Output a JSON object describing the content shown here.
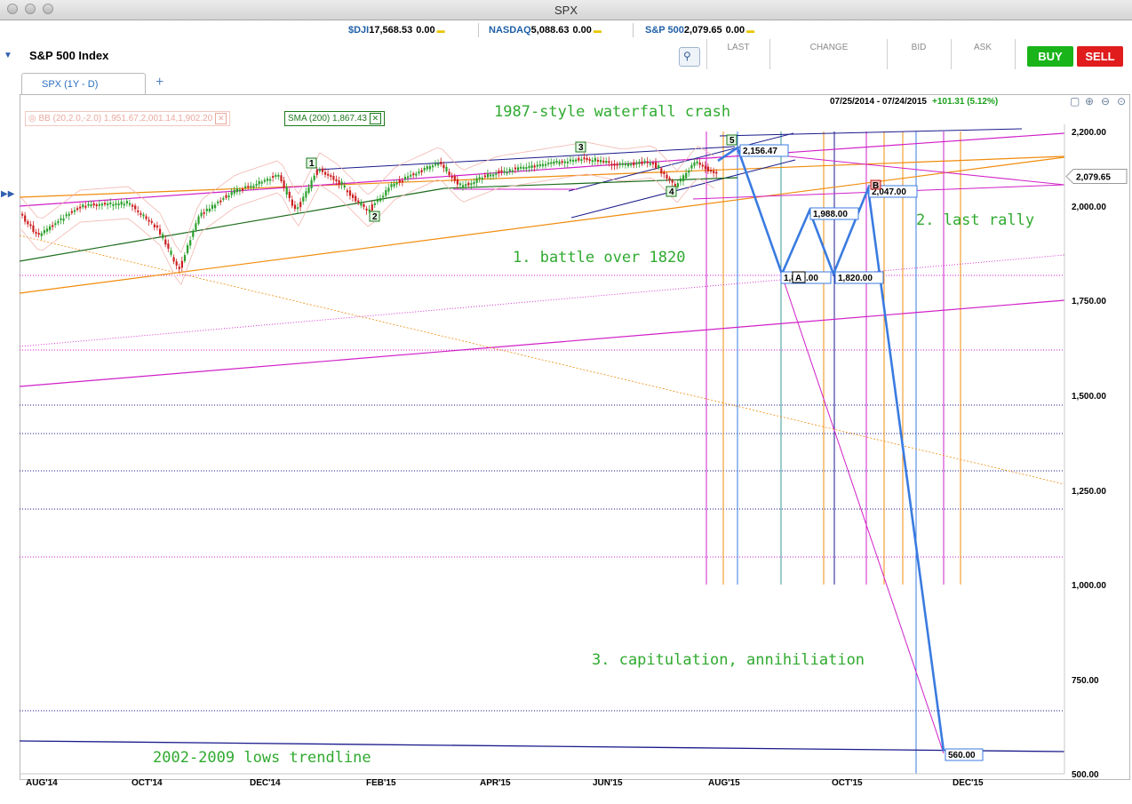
{
  "window": {
    "title": "SPX"
  },
  "tickers": [
    {
      "symbol": "$DJI",
      "value": "17,568.53",
      "change": "0.00"
    },
    {
      "symbol": "NASDAQ",
      "value": "5,088.63",
      "change": "0.00"
    },
    {
      "symbol": "S&P 500",
      "value": "2,079.65",
      "change": "0.00"
    }
  ],
  "header": {
    "title": "S&P 500 Index"
  },
  "quote_columns": [
    "LAST",
    "CHANGE",
    "BID",
    "ASK"
  ],
  "buttons": {
    "buy": "BUY",
    "sell": "SELL"
  },
  "tabs": [
    {
      "label": "SPX (1Y - D)"
    }
  ],
  "add_tab": "+",
  "range": {
    "dates": "07/25/2014 - 07/24/2015",
    "change": "+101.31 (5.12%)"
  },
  "zoom_icons": [
    "zoom-fit-icon",
    "zoom-in-icon",
    "zoom-out-icon",
    "zoom-reset-icon"
  ],
  "indicators": {
    "bb": "BB (20,2.0,-2.0) 1,951.67,2,001.14,1,902.20",
    "sma": "SMA (200) 1,867.43"
  },
  "colors": {
    "up": "#2ca02c",
    "down": "#cc1f1f",
    "projection": "#3a7be0",
    "sma": "#1b6b1b",
    "orange": "#f08c0c",
    "magenta": "#d020c8",
    "navy": "#1a1a8c",
    "annotation": "#2faa2f",
    "buy": "#19b419",
    "sell": "#e01c1c"
  },
  "chart_data": {
    "type": "line",
    "yticks": [
      "2,200.00",
      "2,000.00",
      "1,750.00",
      "1,500.00",
      "1,250.00",
      "1,000.00",
      "750.00",
      "500.00"
    ],
    "ylim": [
      500,
      2200
    ],
    "xticks": [
      "AUG'14",
      "OCT'14",
      "DEC'14",
      "FEB'15",
      "APR'15",
      "JUN'15",
      "AUG'15",
      "OCT'15",
      "DEC'15"
    ],
    "last_price": "2,079.65",
    "wave_labels": [
      "1",
      "2",
      "3",
      "4",
      "5"
    ],
    "point_labels": [
      "A",
      "B"
    ],
    "projection_values": [
      {
        "label": "2,156.47",
        "value": 2156.47
      },
      {
        "label": "1,820.00",
        "value": 1820
      },
      {
        "label": "1,988.00",
        "value": 1988
      },
      {
        "label": "1,820.00",
        "value": 1820
      },
      {
        "label": "2,047.00",
        "value": 2047
      },
      {
        "label": "560.00",
        "value": 560
      }
    ],
    "hidden_label": "1,820.00",
    "annotations": [
      "1987-style waterfall crash",
      "1. battle over 1820",
      "2. last rally",
      "3. capitulation, annihiliation",
      "2002-2009 lows trendline"
    ]
  }
}
